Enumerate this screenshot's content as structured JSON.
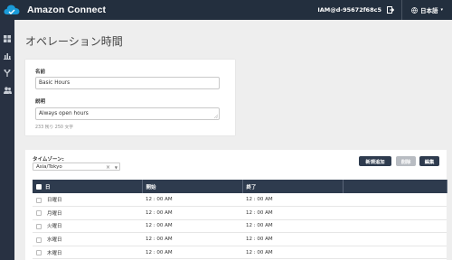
{
  "header": {
    "brand": "Amazon Connect",
    "user": "IAM@d-95672f68c5",
    "language": "日本語",
    "colors": {
      "bar": "#232f3e",
      "accent": "#1a9bd8"
    }
  },
  "sidebar": {
    "items": [
      {
        "icon": "dashboard-icon"
      },
      {
        "icon": "metrics-icon"
      },
      {
        "icon": "routing-icon"
      },
      {
        "icon": "users-icon"
      }
    ]
  },
  "page": {
    "title": "オペレーション時間"
  },
  "form": {
    "name_label": "名前",
    "name_value": "Basic Hours",
    "desc_label": "説明",
    "desc_value": "Always open hours",
    "desc_hint": "233 残り 250 文字"
  },
  "schedule": {
    "timezone_label": "タイムゾーン:",
    "timezone_value": "Asia/Tokyo",
    "buttons": {
      "add": "新規追加",
      "delete": "削除",
      "edit": "編集"
    },
    "columns": [
      "日",
      "開始",
      "終了",
      ""
    ],
    "rows": [
      {
        "day": "日曜日",
        "start": "12 : 00 AM",
        "end": "12 : 00 AM"
      },
      {
        "day": "月曜日",
        "start": "12 : 00 AM",
        "end": "12 : 00 AM"
      },
      {
        "day": "火曜日",
        "start": "12 : 00 AM",
        "end": "12 : 00 AM"
      },
      {
        "day": "水曜日",
        "start": "12 : 00 AM",
        "end": "12 : 00 AM"
      },
      {
        "day": "木曜日",
        "start": "12 : 00 AM",
        "end": "12 : 00 AM"
      }
    ]
  }
}
